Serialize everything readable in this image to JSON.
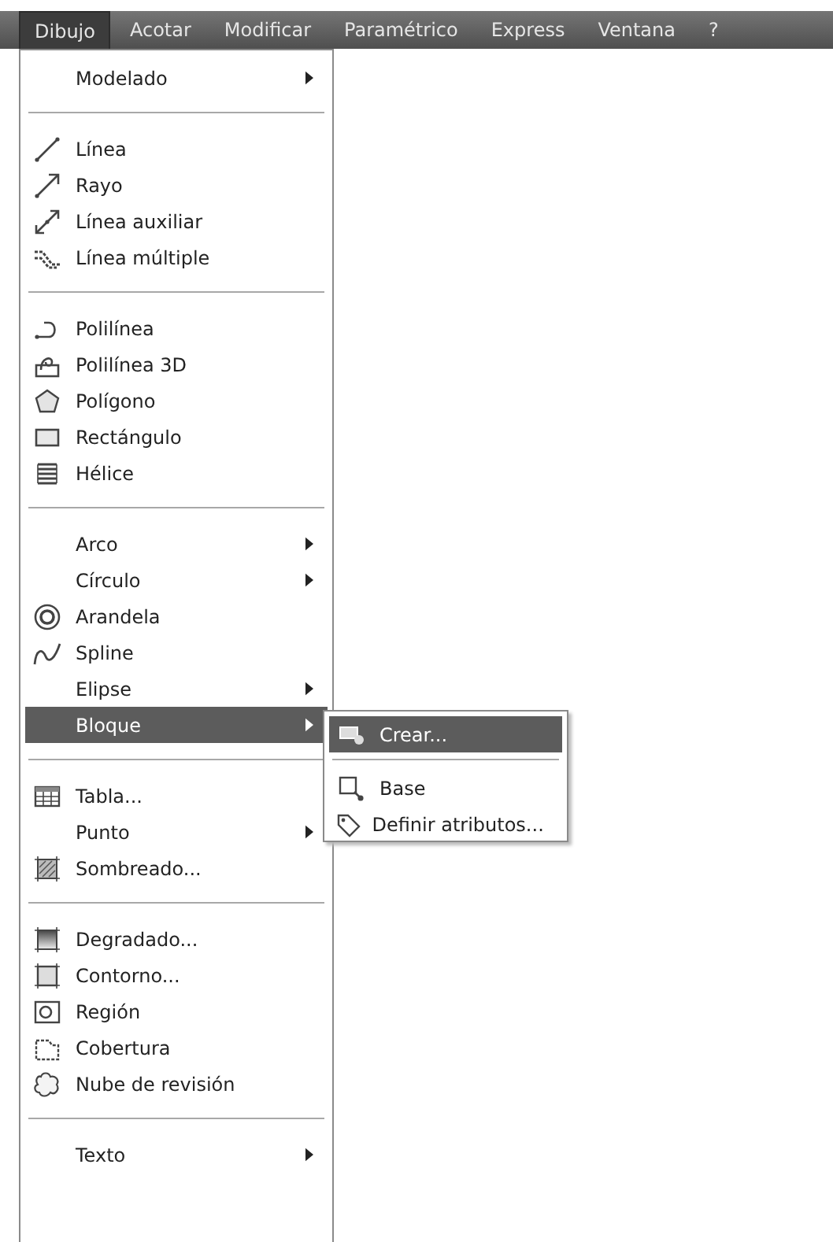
{
  "menu_bar": [
    {
      "label": "Dibujo",
      "selected": true
    },
    {
      "label": "Acotar",
      "selected": false
    },
    {
      "label": "Modificar",
      "selected": false
    },
    {
      "label": "Paramétrico",
      "selected": false
    },
    {
      "label": "Express",
      "selected": false
    },
    {
      "label": "Ventana",
      "selected": false
    },
    {
      "label": "?",
      "selected": false
    }
  ],
  "menu": {
    "items": [
      {
        "kind": "item",
        "label": "Modelado",
        "submenu": true,
        "selected": false
      },
      {
        "kind": "separator"
      },
      {
        "kind": "item",
        "label": "Línea",
        "submenu": false,
        "selected": false
      },
      {
        "kind": "item",
        "label": "Rayo",
        "submenu": false,
        "selected": false
      },
      {
        "kind": "item",
        "label": "Línea auxiliar",
        "submenu": false,
        "selected": false
      },
      {
        "kind": "item",
        "label": "Línea múltiple",
        "submenu": false,
        "selected": false
      },
      {
        "kind": "separator"
      },
      {
        "kind": "item",
        "label": "Polilínea",
        "submenu": false,
        "selected": false
      },
      {
        "kind": "item",
        "label": "Polilínea 3D",
        "submenu": false,
        "selected": false
      },
      {
        "kind": "item",
        "label": "Polígono",
        "submenu": false,
        "selected": false
      },
      {
        "kind": "item",
        "label": "Rectángulo",
        "submenu": false,
        "selected": false
      },
      {
        "kind": "item",
        "label": "Hélice",
        "submenu": false,
        "selected": false
      },
      {
        "kind": "separator"
      },
      {
        "kind": "item",
        "label": "Arco",
        "submenu": true,
        "selected": false
      },
      {
        "kind": "item",
        "label": "Círculo",
        "submenu": true,
        "selected": false
      },
      {
        "kind": "item",
        "label": "Arandela",
        "submenu": false,
        "selected": false
      },
      {
        "kind": "item",
        "label": "Spline",
        "submenu": false,
        "selected": false
      },
      {
        "kind": "item",
        "label": "Elipse",
        "submenu": true,
        "selected": false
      },
      {
        "kind": "item",
        "label": "Bloque",
        "submenu": true,
        "selected": true
      },
      {
        "kind": "separator"
      },
      {
        "kind": "item",
        "label": "Tabla...",
        "submenu": false,
        "selected": false
      },
      {
        "kind": "item",
        "label": "Punto",
        "submenu": true,
        "selected": false
      },
      {
        "kind": "item",
        "label": "Sombreado...",
        "submenu": false,
        "selected": false
      },
      {
        "kind": "separator"
      },
      {
        "kind": "item",
        "label": "Degradado...",
        "submenu": false,
        "selected": false
      },
      {
        "kind": "item",
        "label": "Contorno...",
        "submenu": false,
        "selected": false
      },
      {
        "kind": "item",
        "label": "Región",
        "submenu": false,
        "selected": false
      },
      {
        "kind": "item",
        "label": "Cobertura",
        "submenu": false,
        "selected": false
      },
      {
        "kind": "item",
        "label": "Nube de revisión",
        "submenu": false,
        "selected": false
      },
      {
        "kind": "separator"
      },
      {
        "kind": "item",
        "label": "Texto",
        "submenu": true,
        "selected": false
      }
    ]
  },
  "submenu": {
    "items": [
      {
        "kind": "item",
        "label": "Crear...",
        "selected": true
      },
      {
        "kind": "separator"
      },
      {
        "kind": "item",
        "label": "Base",
        "selected": false
      },
      {
        "kind": "item",
        "label": "Definir atributos...",
        "selected": false
      }
    ]
  }
}
